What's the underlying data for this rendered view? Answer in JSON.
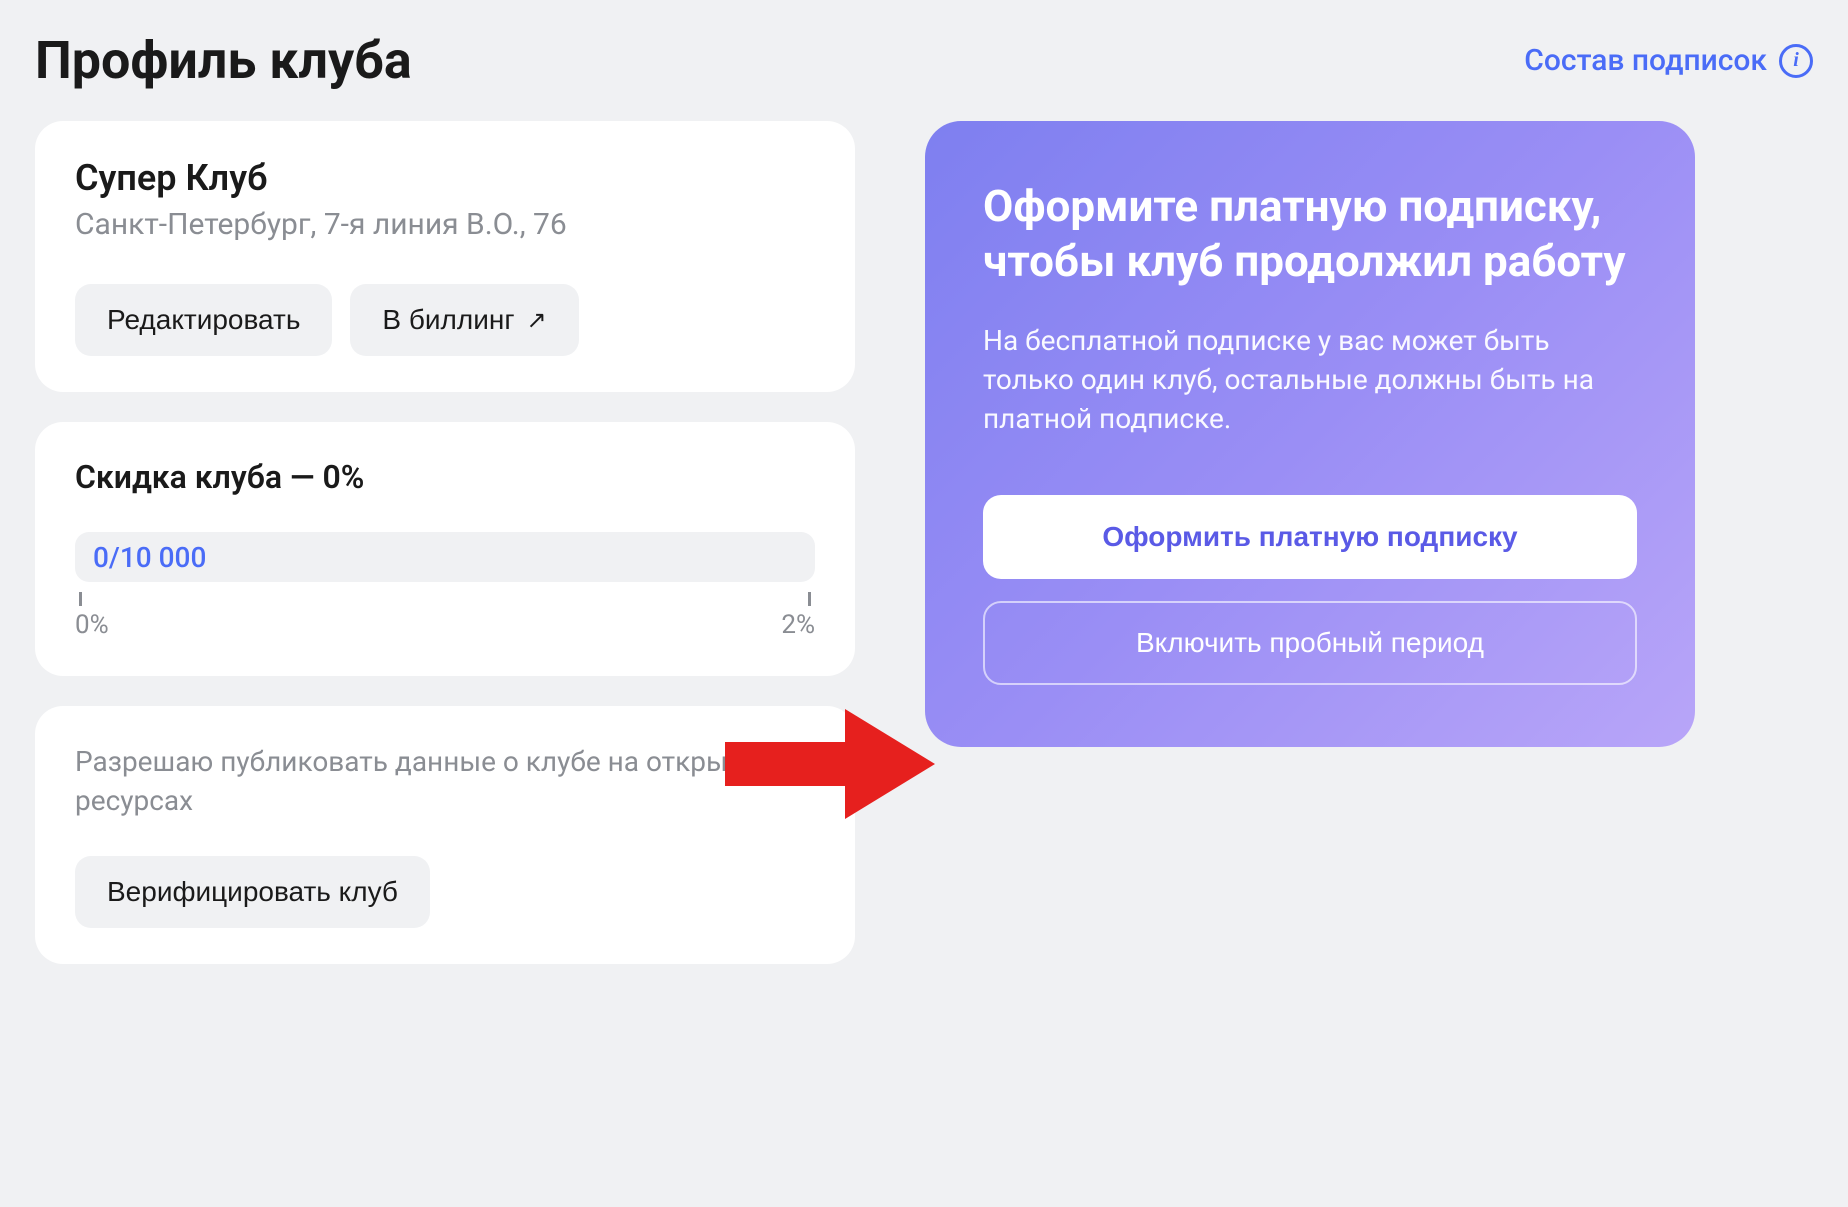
{
  "header": {
    "title": "Профиль клуба",
    "subscriptionLink": "Состав подписок"
  },
  "clubCard": {
    "name": "Супер Клуб",
    "address": "Санкт-Петербург, 7-я линия В.О., 76",
    "editButton": "Редактировать",
    "billingButton": "В биллинг"
  },
  "discountCard": {
    "title": "Скидка клуба — 0%",
    "progressValue": "0/10 000",
    "minLabel": "0%",
    "maxLabel": "2%"
  },
  "verifyCard": {
    "publishText": "Разрешаю публиковать данные о клубе на открытых ресурсах",
    "verifyButton": "Верифицировать клуб"
  },
  "promoCard": {
    "title": "Оформите платную подписку, чтобы клуб продолжил работу",
    "description": "На бесплатной подписке у вас может быть только один клуб, остальные должны быть на платной подписке.",
    "primaryButton": "Оформить платную подписку",
    "secondaryButton": "Включить пробный период"
  }
}
